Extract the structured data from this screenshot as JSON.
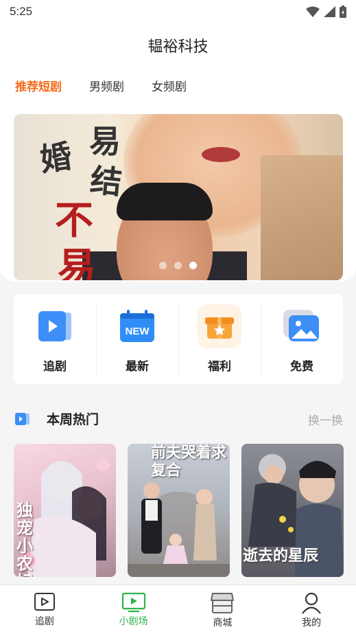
{
  "status": {
    "time": "5:25"
  },
  "header": {
    "title": "韫裕科技",
    "tabs": [
      {
        "label": "推荐短剧",
        "active": true
      },
      {
        "label": "男频剧",
        "active": false
      },
      {
        "label": "女频剧",
        "active": false
      }
    ]
  },
  "banner": {
    "title_chars": [
      "婚",
      "易",
      "结",
      "不",
      "易"
    ],
    "slide_count": 3,
    "active_slide": 3
  },
  "quick_actions": [
    {
      "label": "追剧",
      "icon": "play-screen-icon"
    },
    {
      "label": "最新",
      "icon": "new-calendar-icon",
      "badge": "NEW"
    },
    {
      "label": "福利",
      "icon": "gift-box-icon"
    },
    {
      "label": "免费",
      "icon": "free-image-icon"
    }
  ],
  "hot_section": {
    "title": "本周热门",
    "more_label": "换一换",
    "cards": [
      {
        "poster_title": "独宠小农妃"
      },
      {
        "poster_title": "前夫哭着求复合"
      },
      {
        "poster_title": "逝去的星辰"
      }
    ]
  },
  "bottom_nav": [
    {
      "label": "追剧",
      "icon": "play-icon",
      "active": false
    },
    {
      "label": "小剧场",
      "icon": "tv-icon",
      "active": true
    },
    {
      "label": "商城",
      "icon": "shop-icon",
      "active": false
    },
    {
      "label": "我的",
      "icon": "user-icon",
      "active": false
    }
  ],
  "colors": {
    "accent_orange": "#f56b1b",
    "accent_green": "#2fb34a",
    "blue": "#3d8ef7"
  }
}
